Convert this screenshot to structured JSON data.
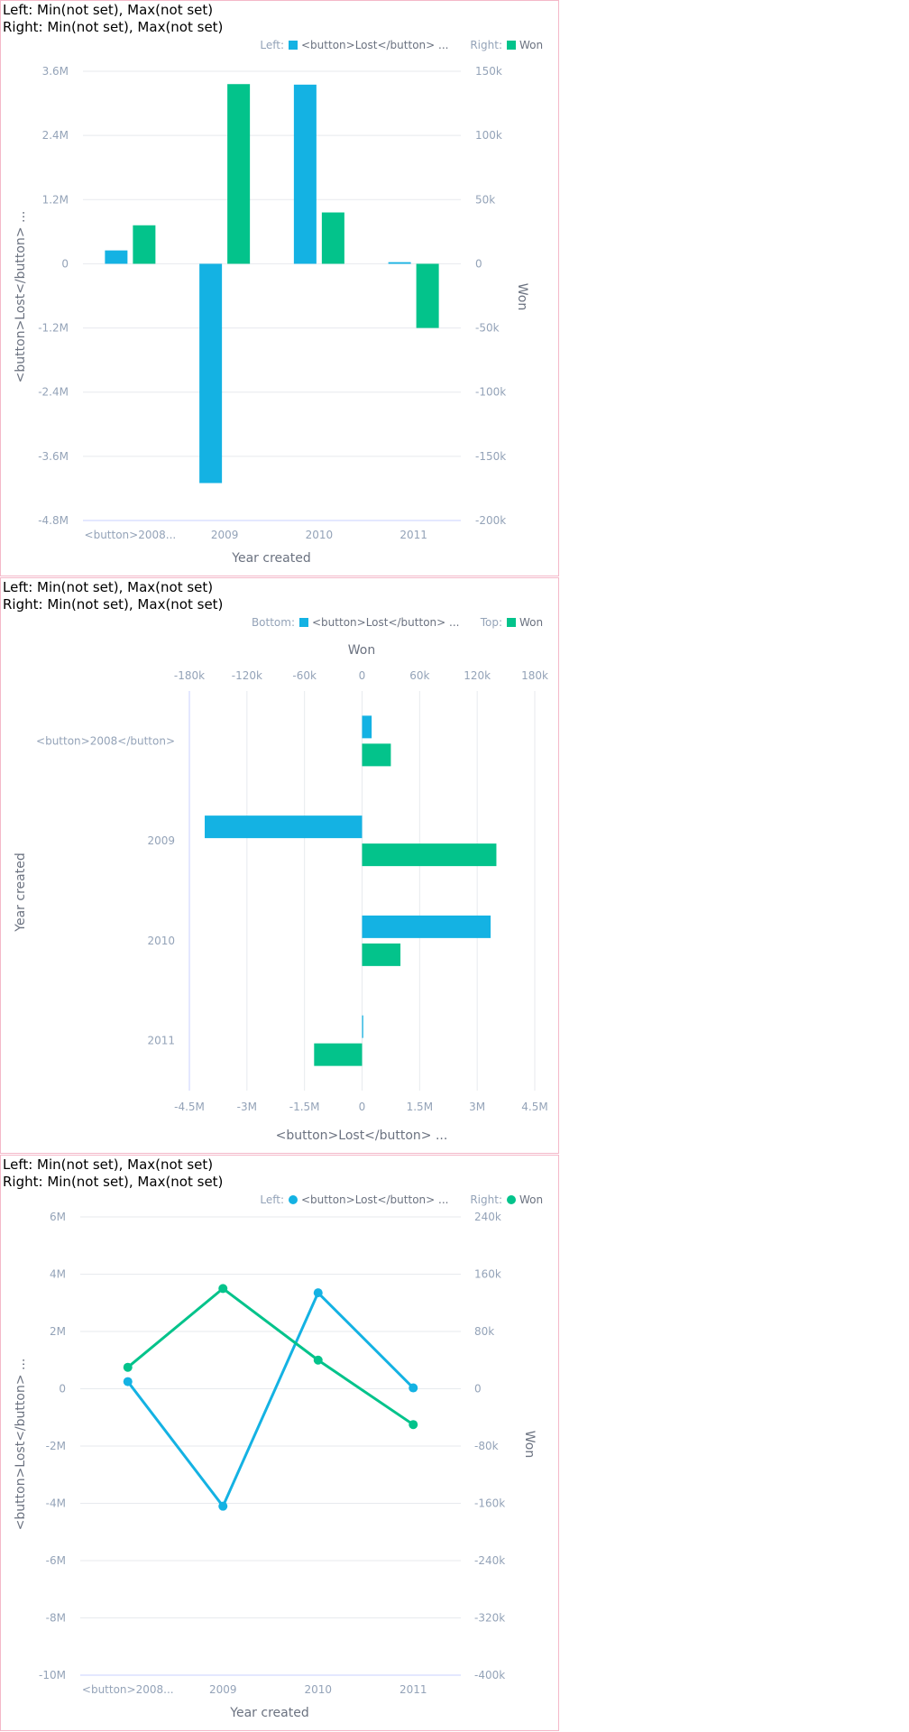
{
  "charts": [
    {
      "heading": {
        "line1": "Left: Min(not set), Max(not set)",
        "line2": "Right: Min(not set), Max(not set)"
      },
      "legend": {
        "first_prefix": "Left:",
        "first_name": "<button>Lost</button> ...",
        "second_prefix": "Right:",
        "second_name": "Won"
      },
      "axis_titles": {
        "x": "Year created",
        "y_left": "<button>Lost</button> ...",
        "y_right": "Won"
      },
      "category_labels": [
        "<button>2008...",
        "2009",
        "2010",
        "2011"
      ],
      "left_ticks": [
        "3.6M",
        "2.4M",
        "1.2M",
        "0",
        "-1.2M",
        "-2.4M",
        "-3.6M",
        "-4.8M"
      ],
      "right_ticks": [
        "150k",
        "100k",
        "50k",
        "0",
        "-50k",
        "-100k",
        "-150k",
        "-200k"
      ]
    },
    {
      "heading": {
        "line1": "Left: Min(not set), Max(not set)",
        "line2": "Right: Min(not set), Max(not set)"
      },
      "legend": {
        "first_prefix": "Bottom:",
        "first_name": "<button>Lost</button> ...",
        "second_prefix": "Top:",
        "second_name": "Won"
      },
      "axis_titles": {
        "top": "Won",
        "bottom": "<button>Lost</button> ...",
        "y": "Year created"
      },
      "category_labels": [
        "<button>2008</button>",
        "2009",
        "2010",
        "2011"
      ],
      "top_ticks": [
        "-180k",
        "-120k",
        "-60k",
        "0",
        "60k",
        "120k",
        "180k"
      ],
      "bottom_ticks": [
        "-4.5M",
        "-3M",
        "-1.5M",
        "0",
        "1.5M",
        "3M",
        "4.5M"
      ]
    },
    {
      "heading": {
        "line1": "Left: Min(not set), Max(not set)",
        "line2": "Right: Min(not set), Max(not set)"
      },
      "legend": {
        "first_prefix": "Left:",
        "first_name": "<button>Lost</button> ...",
        "second_prefix": "Right:",
        "second_name": "Won"
      },
      "axis_titles": {
        "x": "Year created",
        "y_left": "<button>Lost</button> ...",
        "y_right": "Won"
      },
      "category_labels": [
        "<button>2008...",
        "2009",
        "2010",
        "2011"
      ],
      "left_ticks": [
        "6M",
        "4M",
        "2M",
        "0",
        "-2M",
        "-4M",
        "-6M",
        "-8M",
        "-10M"
      ],
      "right_ticks": [
        "240k",
        "160k",
        "80k",
        "0",
        "-80k",
        "-160k",
        "-240k",
        "-320k",
        "-400k"
      ]
    }
  ],
  "colors": {
    "lost": "#14b2e3",
    "won": "#03c38b",
    "tick": "#94a3b8",
    "title": "#6b7280",
    "grid": "#e7eaee",
    "axis": "#c9d2ff",
    "legend_text": "#6b7280"
  },
  "chart_data": [
    {
      "type": "bar",
      "categories": [
        "<button>2008</button>",
        "2009",
        "2010",
        "2011"
      ],
      "series": [
        {
          "name": "<button>Lost</button> ...",
          "axis": "left",
          "values": [
            250000,
            -4100000,
            3350000,
            30000
          ]
        },
        {
          "name": "Won",
          "axis": "right",
          "values": [
            30000,
            140000,
            40000,
            -50000
          ]
        }
      ],
      "xlabel": "Year created",
      "ylabel_left": "<button>Lost</button> ...",
      "ylabel_right": "Won",
      "ylim_left": [
        -4800000,
        3600000
      ],
      "ylim_right": [
        -200000,
        150000
      ],
      "grid": true,
      "legend": "top-right"
    },
    {
      "type": "bar",
      "orientation": "horizontal",
      "categories": [
        "<button>2008</button>",
        "2009",
        "2010",
        "2011"
      ],
      "series": [
        {
          "name": "<button>Lost</button> ...",
          "axis": "bottom",
          "values": [
            250000,
            -4100000,
            3350000,
            30000
          ]
        },
        {
          "name": "Won",
          "axis": "top",
          "values": [
            30000,
            140000,
            40000,
            -50000
          ]
        }
      ],
      "xlabel_bottom": "<button>Lost</button> ...",
      "xlabel_top": "Won",
      "ylabel": "Year created",
      "xlim_bottom": [
        -4500000,
        4500000
      ],
      "xlim_top": [
        -180000,
        180000
      ],
      "grid": true,
      "legend": "top-right"
    },
    {
      "type": "line",
      "categories": [
        "<button>2008</button>",
        "2009",
        "2010",
        "2011"
      ],
      "series": [
        {
          "name": "<button>Lost</button> ...",
          "axis": "left",
          "values": [
            250000,
            -4100000,
            3350000,
            30000
          ]
        },
        {
          "name": "Won",
          "axis": "right",
          "values": [
            30000,
            140000,
            40000,
            -50000
          ]
        }
      ],
      "xlabel": "Year created",
      "ylabel_left": "<button>Lost</button> ...",
      "ylabel_right": "Won",
      "ylim_left": [
        -10000000,
        6000000
      ],
      "ylim_right": [
        -400000,
        240000
      ],
      "grid": true,
      "legend": "top-right"
    }
  ]
}
